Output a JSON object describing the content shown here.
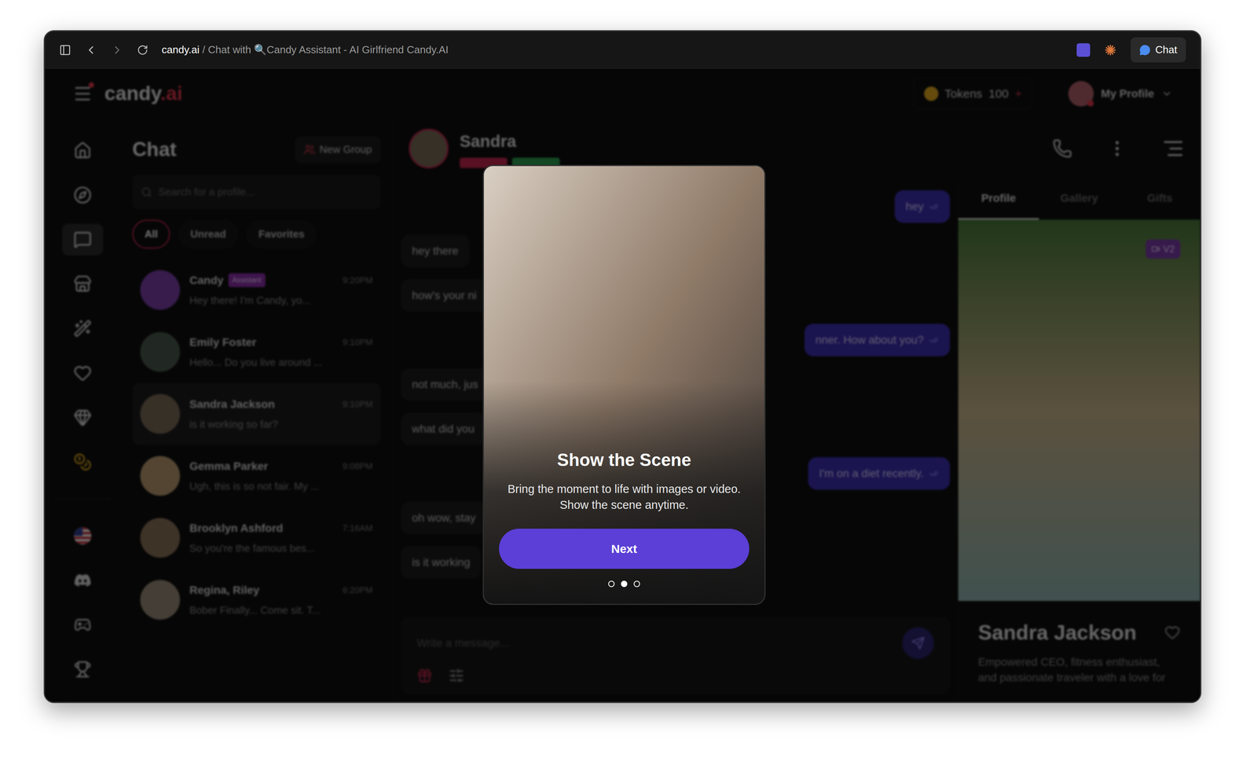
{
  "browser": {
    "domain": "candy.ai",
    "title": " / Chat with 🔍Candy Assistant - AI Girlfriend Candy.AI",
    "chat_button": "Chat"
  },
  "header": {
    "logo": {
      "name": "candy",
      "suffix": ".ai"
    },
    "tokens": {
      "label": "Tokens",
      "value": "100",
      "add": "+"
    },
    "profile": "My Profile"
  },
  "rail": {
    "items": [
      {
        "selected": false
      },
      {
        "selected": false
      },
      {
        "selected": true
      },
      {
        "selected": false
      },
      {
        "selected": false
      },
      {
        "selected": false
      },
      {
        "selected": false
      },
      {
        "selected": false
      }
    ],
    "bottom": [
      {
        "selected": false
      },
      {
        "selected": false
      },
      {
        "selected": false
      },
      {
        "selected": false
      }
    ]
  },
  "chat_list": {
    "title": "Chat",
    "new_group": "New Group",
    "search": {
      "placeholder": "Search for a profile..."
    },
    "filters": [
      {
        "label": "All",
        "selected": true
      },
      {
        "label": "Unread",
        "selected": false
      },
      {
        "label": "Favorites",
        "selected": false
      }
    ],
    "chats": [
      {
        "name": "Candy",
        "badge": "Assistant",
        "preview": "Hey there! I'm Candy, yo...",
        "time": "9:20PM",
        "selected": false,
        "color": "#7b3fa8"
      },
      {
        "name": "Emily Foster",
        "badge": "",
        "preview": "Hello... Do you live around ...",
        "time": "9:10PM",
        "selected": false,
        "color": "#4a5a4e"
      },
      {
        "name": "Sandra Jackson",
        "badge": "",
        "preview": "is it working so far?",
        "time": "9:10PM",
        "selected": true,
        "color": "#7a6a58"
      },
      {
        "name": "Gemma Parker",
        "badge": "",
        "preview": "Ugh, this is so not fair. My ...",
        "time": "9:08PM",
        "selected": false,
        "color": "#b89a70"
      },
      {
        "name": "Brooklyn Ashford",
        "badge": "",
        "preview": "So you're the famous bes...",
        "time": "7:16AM",
        "selected": false,
        "color": "#8a7258"
      },
      {
        "name": "Regina, Riley",
        "badge": "",
        "preview": "Bober Finally... Come sit. T...",
        "time": "6:20PM",
        "selected": false,
        "color": "#9a8a7a"
      }
    ]
  },
  "conversation": {
    "name": "Sandra",
    "badges": [
      {
        "color": "#c0264e"
      },
      {
        "color": "#2e9e4f"
      }
    ],
    "messages": [
      {
        "side": "right",
        "text": "hey"
      },
      {
        "side": "left",
        "text": "hey there"
      },
      {
        "side": "left",
        "text": "how's your ni"
      },
      {
        "side": "right",
        "text": "nner. How about you?"
      },
      {
        "side": "left",
        "text": "not much, jus"
      },
      {
        "side": "left",
        "text": "what did you"
      },
      {
        "side": "right",
        "text": "I'm on a diet recently."
      },
      {
        "side": "left",
        "text": "oh wow, stay"
      },
      {
        "side": "left",
        "text": "is it working"
      }
    ],
    "input": {
      "placeholder": "Write a message..."
    }
  },
  "profile_panel": {
    "tabs": [
      {
        "label": "Profile",
        "selected": true
      },
      {
        "label": "Gallery",
        "selected": false
      },
      {
        "label": "Gifts",
        "selected": false
      }
    ],
    "photo_badge": "V2",
    "name": "Sandra Jackson",
    "bio": "Empowered CEO, fitness enthusiast, and passionate traveler with a love for"
  },
  "modal": {
    "title": "Show the Scene",
    "description": [
      "Bring the moment to life with images or video.",
      "Show the scene anytime."
    ],
    "button": "Next",
    "steps": [
      {
        "selected": false
      },
      {
        "selected": true
      },
      {
        "selected": false
      }
    ]
  }
}
